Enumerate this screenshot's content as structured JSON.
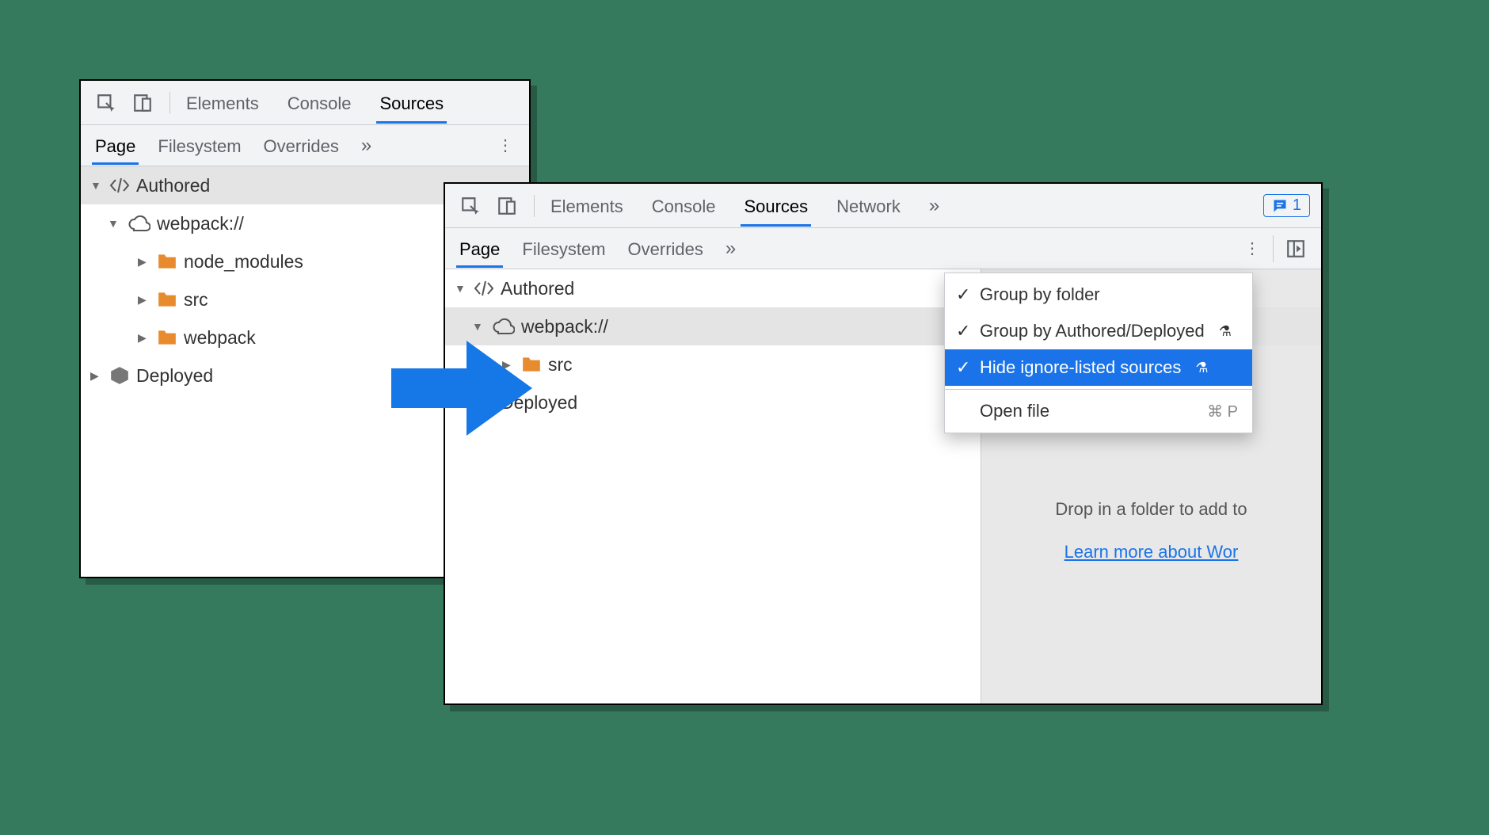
{
  "left": {
    "top_tabs": {
      "elements": "Elements",
      "console": "Console",
      "sources": "Sources",
      "active": "sources"
    },
    "sub_tabs": {
      "page": "Page",
      "filesystem": "Filesystem",
      "overrides": "Overrides",
      "active": "page"
    },
    "tree": {
      "authored": "Authored",
      "webpack": "webpack://",
      "node_modules": "node_modules",
      "src": "src",
      "webpack_folder": "webpack",
      "deployed": "Deployed"
    }
  },
  "right": {
    "top_tabs": {
      "elements": "Elements",
      "console": "Console",
      "sources": "Sources",
      "network": "Network",
      "active": "sources"
    },
    "sub_tabs": {
      "page": "Page",
      "filesystem": "Filesystem",
      "overrides": "Overrides",
      "active": "page"
    },
    "issues_count": "1",
    "tree": {
      "authored": "Authored",
      "webpack": "webpack://",
      "src": "src",
      "deployed": "Deployed"
    },
    "menu": {
      "group_folder": "Group by folder",
      "group_authored": "Group by Authored/Deployed",
      "hide_ignored": "Hide ignore-listed sources",
      "open_file": "Open file",
      "open_file_shortcut": "⌘ P"
    },
    "hint": {
      "drop": "Drop in a folder to add to",
      "learn": "Learn more about Wor"
    }
  }
}
